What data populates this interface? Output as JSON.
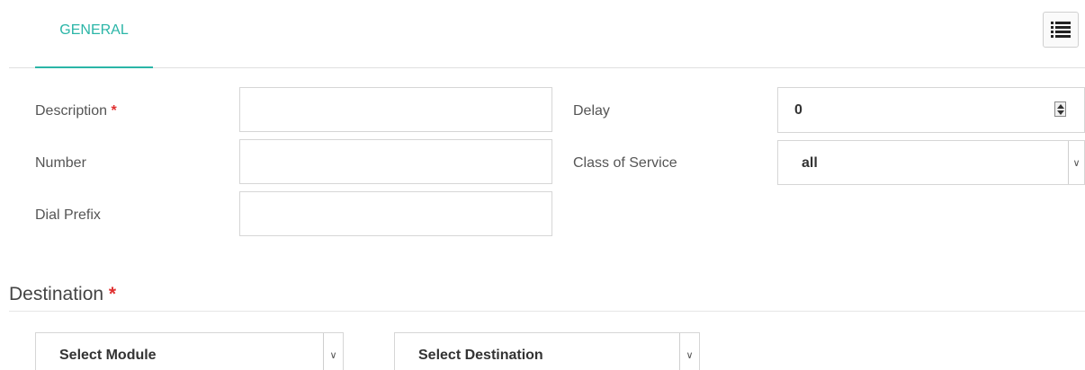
{
  "tabs": {
    "general_label": "GENERAL",
    "menu_icon": "list-icon"
  },
  "form": {
    "description": {
      "label": "Description",
      "required_mark": "*",
      "value": ""
    },
    "number": {
      "label": "Number",
      "value": ""
    },
    "dial_prefix": {
      "label": "Dial Prefix",
      "value": ""
    },
    "delay": {
      "label": "Delay",
      "value": "0"
    },
    "class_of_service": {
      "label": "Class of Service",
      "selected": "all"
    }
  },
  "destination": {
    "title": "Destination",
    "required_mark": "*",
    "module_select": {
      "selected": "Select Module"
    },
    "destination_select": {
      "selected": "Select Destination"
    }
  },
  "colors": {
    "accent": "#2ab5a7",
    "required": "#e03030"
  }
}
